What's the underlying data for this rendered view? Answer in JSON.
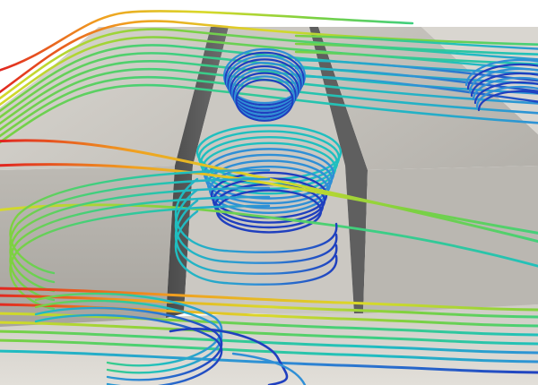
{
  "scene": {
    "subject": "streamline-flow-visualization",
    "colormap": [
      "#1f3fbf",
      "#2f8fd6",
      "#1fbfbf",
      "#3fcf7f",
      "#7fd13f",
      "#d9d92a",
      "#f0a020",
      "#e02020"
    ],
    "geometry_colors": {
      "top_face": "#cfccc6",
      "top_face_dark": "#bcb9b3",
      "side_face": "#b9b6b0",
      "side_face_dark": "#a9a6a0",
      "floor": "#d6d3cd",
      "cavity_wall": "#5b5b5b",
      "cavity_wall_light": "#777777"
    }
  }
}
